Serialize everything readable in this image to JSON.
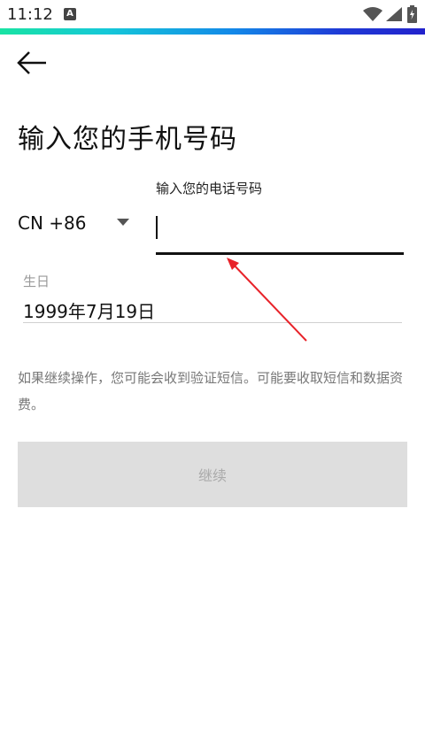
{
  "status_bar": {
    "time": "11:12",
    "notification_icon": "font-a-icon",
    "wifi_icon": "wifi-icon",
    "signal_icon": "signal-icon",
    "battery_icon": "battery-icon"
  },
  "header": {
    "back_icon": "arrow-left-icon",
    "title": "输入您的手机号码"
  },
  "phone": {
    "label": "输入您的电话号码",
    "country_code": "CN +86",
    "value": "",
    "dropdown_icon": "triangle-down-icon"
  },
  "birthday": {
    "label": "生日",
    "value": "1999年7月19日"
  },
  "notice": "如果继续操作，您可能会收到验证短信。可能要收取短信和数据资费。",
  "continue_button": {
    "label": "继续"
  },
  "colors": {
    "progress_gradient": [
      "#19e3a3",
      "#1388e8",
      "#2222cc"
    ],
    "annotation_arrow": "#e8232a",
    "disabled_button_bg": "#dedede",
    "disabled_button_text": "#aaaaaa"
  }
}
